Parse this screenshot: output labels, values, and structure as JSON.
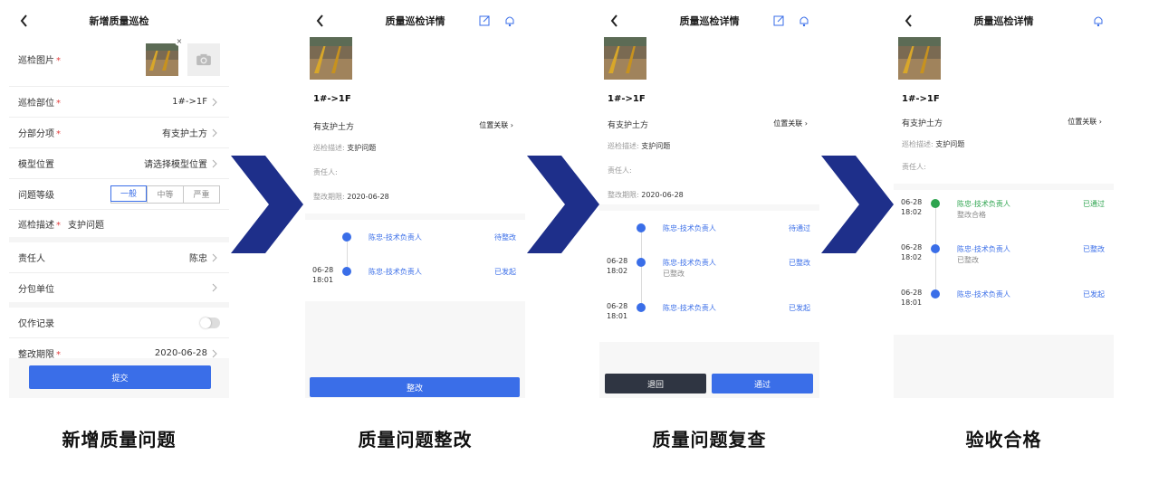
{
  "colors": {
    "accent": "#3a6ee8",
    "success": "#2ea44f",
    "arrow": "#1e2f8a",
    "required": "#e43d3d"
  },
  "screen1": {
    "title": "新增质量巡检",
    "photo_label": "巡检图片",
    "rows": [
      {
        "label": "巡检部位",
        "required": "*",
        "value": "1#->1F"
      },
      {
        "label": "分部分项",
        "required": "*",
        "value": "有支护土方"
      },
      {
        "label": "模型位置",
        "required": "",
        "value": "请选择模型位置"
      }
    ],
    "level_label": "问题等级",
    "levels": [
      "一般",
      "中等",
      "严重"
    ],
    "desc_label": "巡检描述",
    "desc_value": "支护问题",
    "owner_label": "责任人",
    "owner_value": "陈忠",
    "sub_label": "分包单位",
    "record_label": "仅作记录",
    "deadline_label": "整改期限",
    "deadline_value": "2020-06-28",
    "submit": "提交"
  },
  "detail_common": {
    "title": "质量巡检详情",
    "location": "1#->1F",
    "section": "有支护土方",
    "relation": "位置关联",
    "desc_label": "巡检描述:",
    "desc_value": "支护问题",
    "owner_label": "责任人:",
    "deadline_label": "整改期限:",
    "deadline_value": "2020-06-28"
  },
  "screen2": {
    "timeline": [
      {
        "date": "",
        "time": "",
        "name": "陈忠-技术负责人",
        "sub": "",
        "status": "待整改"
      },
      {
        "date": "06-28",
        "time": "18:01",
        "name": "陈忠-技术负责人",
        "sub": "",
        "status": "已发起"
      }
    ],
    "action": "整改"
  },
  "screen3": {
    "timeline": [
      {
        "date": "",
        "time": "",
        "name": "陈忠-技术负责人",
        "sub": "",
        "status": "待通过"
      },
      {
        "date": "06-28",
        "time": "18:02",
        "name": "陈忠-技术负责人",
        "sub": "已整改",
        "status": "已整改"
      },
      {
        "date": "06-28",
        "time": "18:01",
        "name": "陈忠-技术负责人",
        "sub": "",
        "status": "已发起"
      }
    ],
    "reject": "退回",
    "approve": "通过"
  },
  "screen4": {
    "timeline": [
      {
        "date": "06-28",
        "time": "18:02",
        "name": "陈忠-技术负责人",
        "sub": "整改合格",
        "status": "已通过"
      },
      {
        "date": "06-28",
        "time": "18:02",
        "name": "陈忠-技术负责人",
        "sub": "已整改",
        "status": "已整改"
      },
      {
        "date": "06-28",
        "time": "18:01",
        "name": "陈忠-技术负责人",
        "sub": "",
        "status": "已发起"
      }
    ]
  },
  "captions": [
    "新增质量问题",
    "质量问题整改",
    "质量问题复查",
    "验收合格"
  ],
  "icons": [
    "back-arrow-icon",
    "edit-icon",
    "bell-icon",
    "camera-icon",
    "close-icon",
    "chevron-right-icon",
    "step-arrow-icon"
  ]
}
